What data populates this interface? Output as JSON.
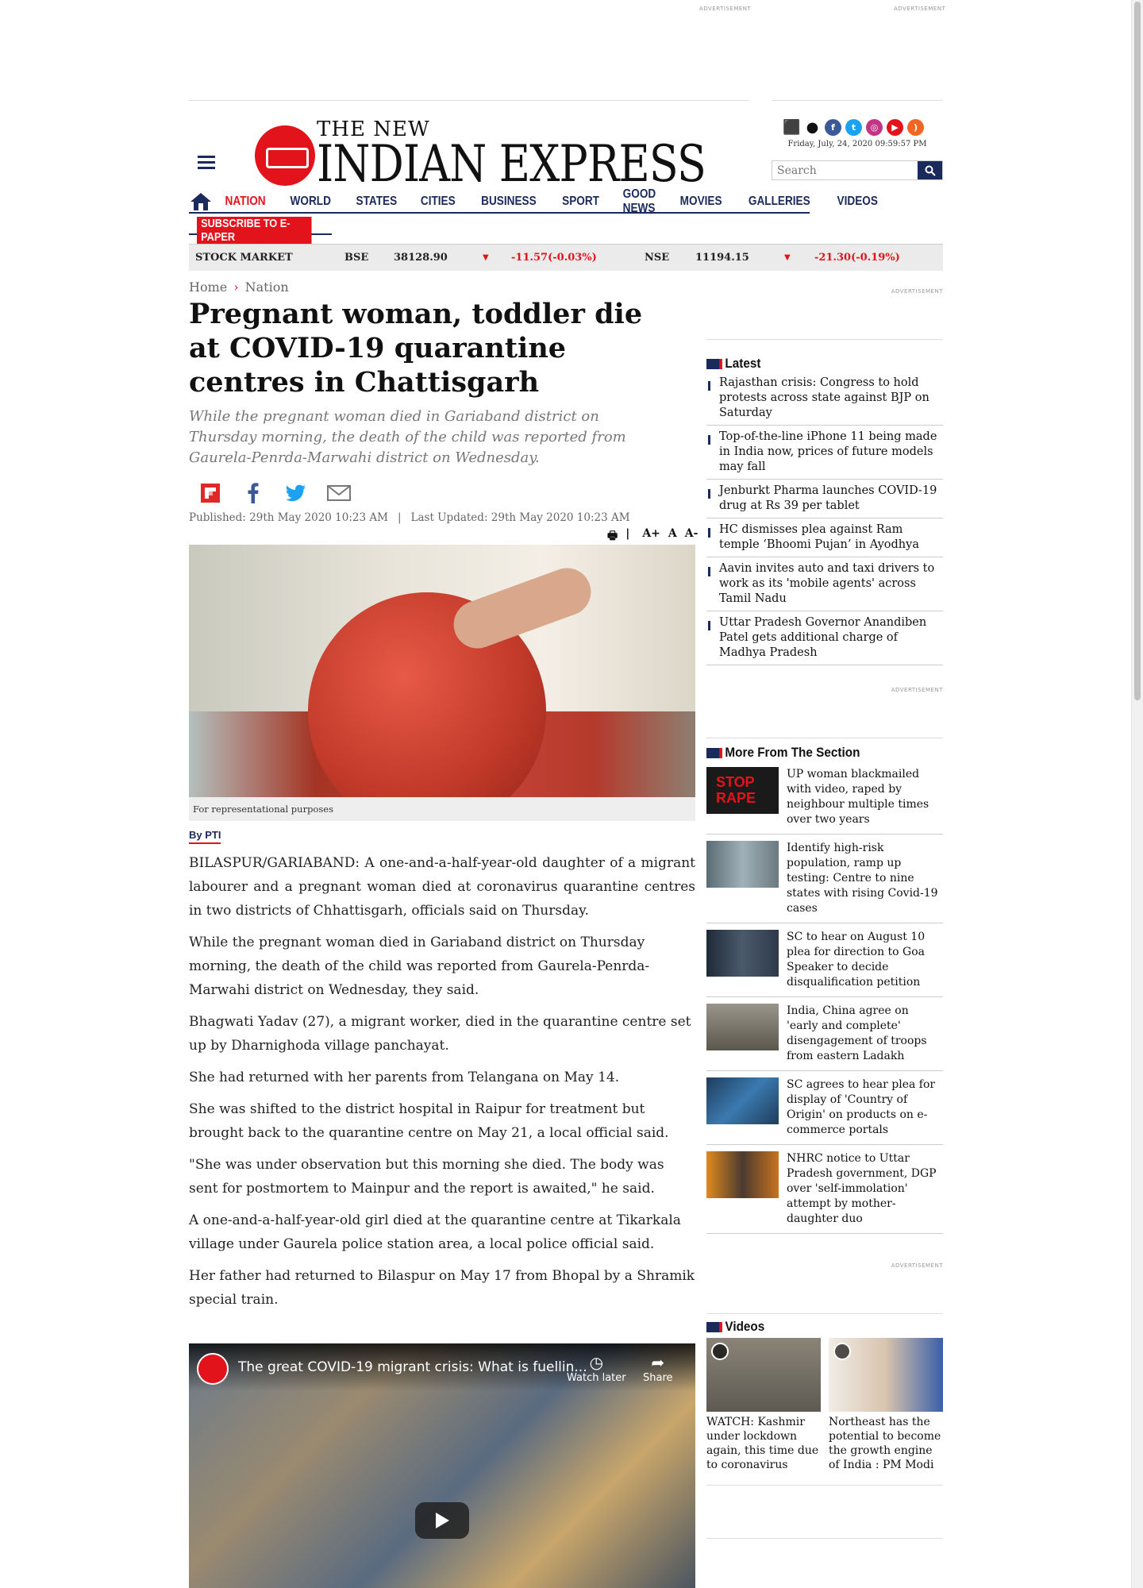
{
  "ads": {
    "label": "ADVERTISEMENT"
  },
  "header": {
    "logo_top": "THE NEW",
    "logo_main": "INDIAN EXPRESS",
    "datetime": "Friday, July, 24, 2020  09:59:57 PM",
    "search_placeholder": "Search",
    "social_icons": [
      "android-icon",
      "apple-icon",
      "facebook-icon",
      "twitter-icon",
      "instagram-icon",
      "youtube-icon",
      "rss-icon"
    ]
  },
  "nav": {
    "items": [
      "NATION",
      "WORLD",
      "STATES",
      "CITIES",
      "BUSINESS",
      "SPORT",
      "GOOD NEWS",
      "MOVIES",
      "GALLERIES",
      "VIDEOS"
    ],
    "subscribe": "SUBSCRIBE TO E-PAPER"
  },
  "stock": {
    "label": "STOCK MARKET",
    "bse": {
      "name": "BSE",
      "value": "38128.90",
      "change": "-11.57(-0.03%)"
    },
    "nse": {
      "name": "NSE",
      "value": "11194.15",
      "change": "-21.30(-0.19%)"
    }
  },
  "article": {
    "breadcrumb": [
      "Home",
      "Nation"
    ],
    "title": "Pregnant woman, toddler die at COVID-19 quarantine centres in Chattisgarh",
    "subtitle": "While the pregnant woman died in Gariaband district on Thursday morning, the death of the child was reported from Gaurela-Penrda-Marwahi district on Wednesday.",
    "published": "Published: 29th May 2020 10:23 AM",
    "updated": "Last Updated: 29th May 2020 10:23 AM",
    "tools": [
      "|",
      "A+",
      "A",
      "A-"
    ],
    "caption": "For representational purposes",
    "byline": "By PTI",
    "paragraphs": [
      "BILASPUR/GARIABAND: A one-and-a-half-year-old daughter of a migrant labourer and a pregnant woman died at coronavirus quarantine centres in two districts of Chhattisgarh, officials said on Thursday.",
      "While the pregnant woman died in Gariaband district on Thursday morning, the death of the child was reported from Gaurela-Penrda-Marwahi district on Wednesday, they said.",
      "Bhagwati Yadav (27), a migrant worker, died in the quarantine centre set up by Dharnighoda village panchayat.",
      "She had returned with her parents from Telangana on May 14.",
      "She was shifted to the district hospital in Raipur for treatment but brought back to the quarantine centre on May 21, a local official said.",
      "\"She was under observation but this morning she died. The body was sent for postmortem to Mainpur and the report is awaited,\" he said.",
      "A one-and-a-half-year-old girl died at the quarantine centre at Tikarkala village under Gaurela police station area, a local police official said.",
      "Her father had returned to Bilaspur on May 17 from Bhopal by a Shramik special train."
    ],
    "video": {
      "title": "The great COVID-19 migrant crisis: What is fuellin...",
      "watch_later": "Watch later",
      "share": "Share"
    }
  },
  "sidebar": {
    "latest_title": "Latest",
    "latest": [
      "Rajasthan crisis: Congress to hold protests across state against BJP on Saturday",
      "Top-of-the-line iPhone 11 being made in India now, prices of future models may fall",
      "Jenburkt Pharma launches COVID-19 drug at Rs 39 per tablet",
      "HC dismisses plea against Ram temple ‘Bhoomi Pujan’ in Ayodhya",
      "Aavin invites auto and taxi drivers to work as its 'mobile agents' across Tamil Nadu",
      "Uttar Pradesh Governor Anandiben Patel gets additional charge of Madhya Pradesh"
    ],
    "more_title": "More From The Section",
    "more": [
      {
        "text": "UP woman blackmailed with video, raped by neighbour multiple times over two years",
        "thumb_color": "#1a1a1a",
        "thumb_text": "STOP RAPE"
      },
      {
        "text": "Identify high-risk population, ramp up testing: Centre to nine states with rising Covid-19 cases",
        "thumb_color": "#7b8c95"
      },
      {
        "text": "SC to hear on August 10 plea for direction to Goa Speaker to decide disqualification petition",
        "thumb_color": "#2e3a4a"
      },
      {
        "text": "India, China agree on 'early and complete' disengagement of troops from eastern Ladakh",
        "thumb_color": "#6f6a5e"
      },
      {
        "text": "SC agrees to hear plea for display of 'Country of Origin' on products on e-commerce portals",
        "thumb_color": "#2d5f8c"
      },
      {
        "text": "NHRC notice to Uttar Pradesh government, DGP over 'self-immolation' attempt by mother-daughter duo",
        "thumb_color": "#c7731e"
      }
    ],
    "videos_title": "Videos",
    "videos": [
      {
        "text": "WATCH: Kashmir under lockdown again, this time due to coronavirus",
        "thumb_color": "#6e6a62"
      },
      {
        "text": "Northeast has the potential to become the growth engine of India : PM Modi",
        "thumb_color": "#c9b9a5"
      }
    ]
  }
}
